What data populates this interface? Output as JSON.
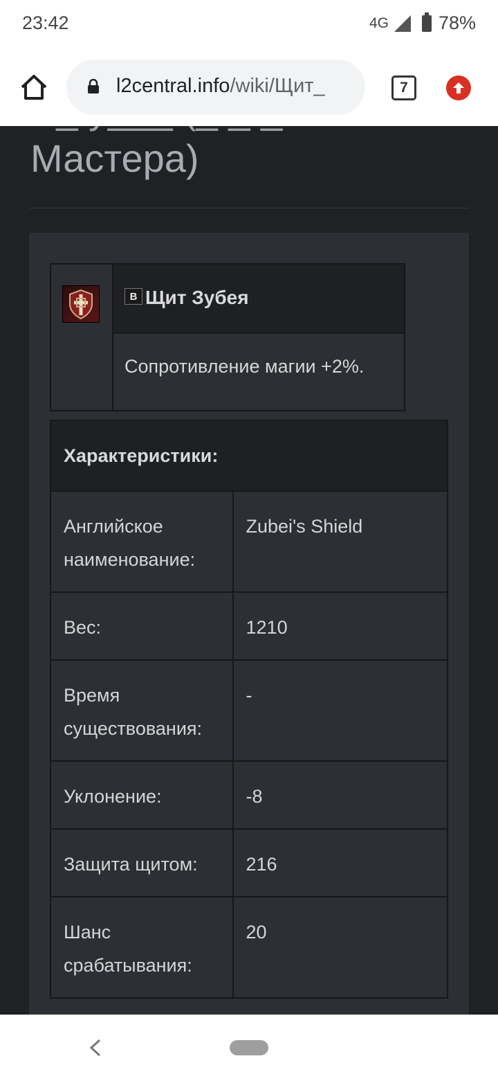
{
  "status_bar": {
    "time": "23:42",
    "network": "4G",
    "battery": "78%"
  },
  "browser": {
    "url_domain": "l2central.info",
    "url_path": "/wiki/Щит_",
    "tab_count": "7",
    "icons": {
      "home": "home-icon",
      "lock": "lock-icon",
      "update": "update-arrow-icon"
    },
    "accent_color": "#d93025"
  },
  "page": {
    "title_line1": "Ч_ у___ (_ _ _",
    "title_line2": "Мастера)",
    "item": {
      "grade": "B",
      "name": "Щит Зубея",
      "description": "Сопротивление магии +2%."
    },
    "stats": {
      "header": "Характеристики:",
      "rows": [
        {
          "label": "Английское наименование:",
          "value": "Zubei's Shield"
        },
        {
          "label": "Вес:",
          "value": "1210"
        },
        {
          "label": "Время существования:",
          "value": "-"
        },
        {
          "label": "Уклонение:",
          "value": "-8"
        },
        {
          "label": "Защита щитом:",
          "value": "216"
        },
        {
          "label": "Шанс срабатывания:",
          "value": "20"
        }
      ]
    }
  }
}
